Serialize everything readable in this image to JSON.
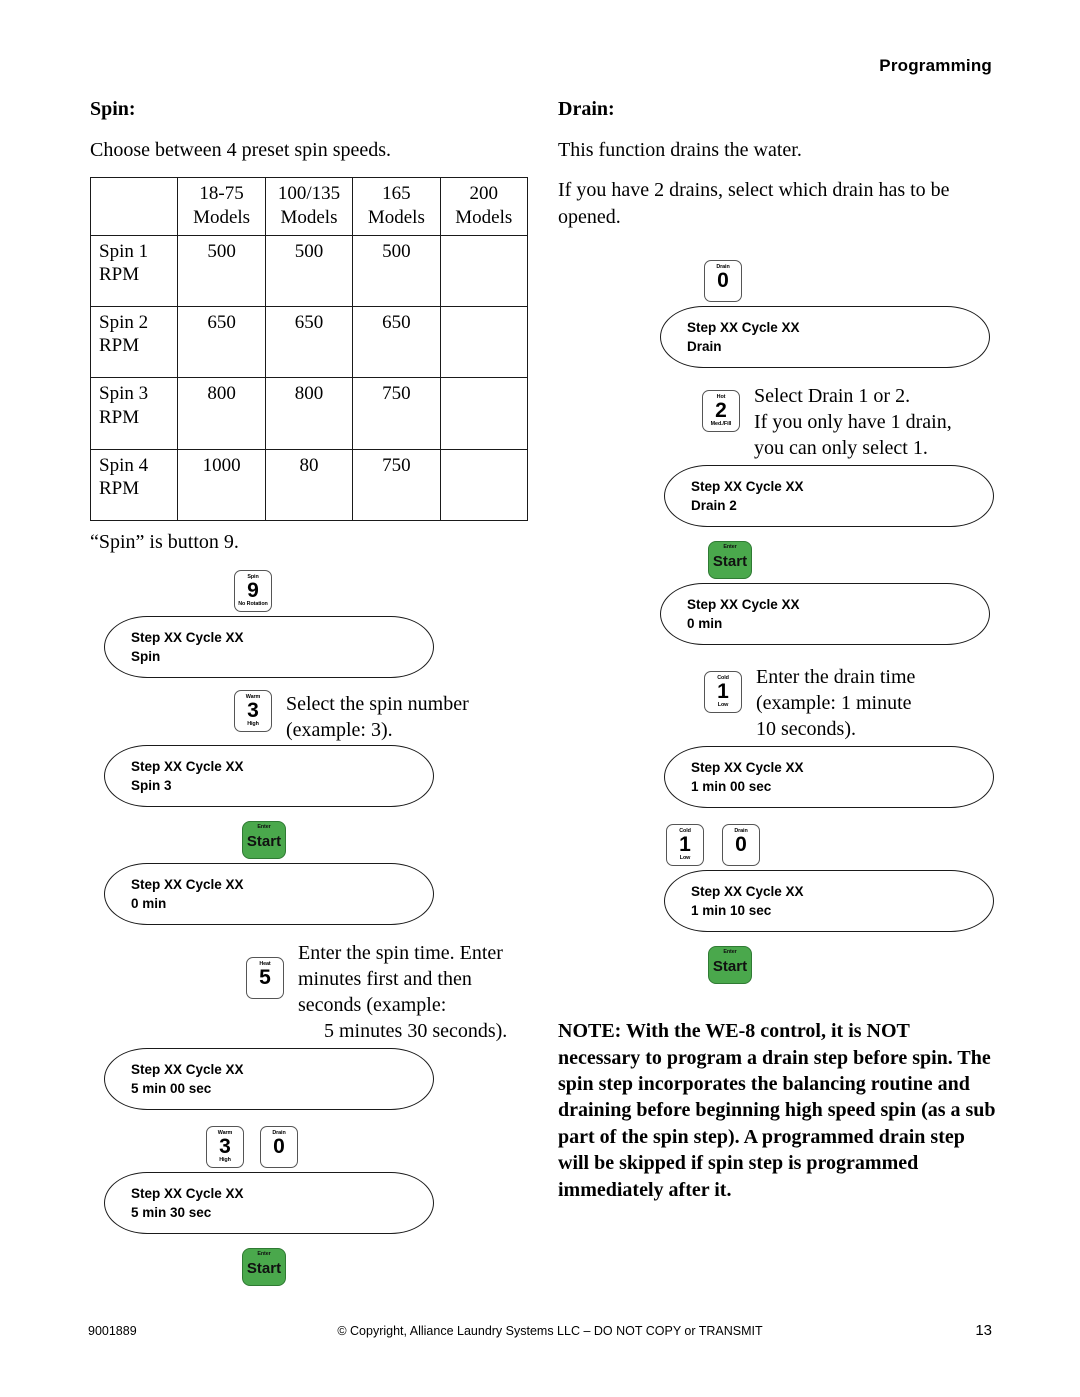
{
  "header": {
    "title": "Programming"
  },
  "left": {
    "section_title": "Spin:",
    "intro": "Choose between 4 preset spin speeds.",
    "table": {
      "headers": [
        "",
        "18-75\nModels",
        "100/135\nModels",
        "165\nModels",
        "200\nModels"
      ],
      "header_cells": [
        {
          "line1": "",
          "line2": ""
        },
        {
          "line1": "18-75",
          "line2": "Models"
        },
        {
          "line1": "100/135",
          "line2": "Models"
        },
        {
          "line1": "165",
          "line2": "Models"
        },
        {
          "line1": "200",
          "line2": "Models"
        }
      ],
      "rows": [
        {
          "label_line1": "Spin 1",
          "label_line2": "RPM",
          "v1": "500",
          "v2": "500",
          "v3": "500",
          "v4": ""
        },
        {
          "label_line1": "Spin 2",
          "label_line2": "RPM",
          "v1": "650",
          "v2": "650",
          "v3": "650",
          "v4": ""
        },
        {
          "label_line1": "Spin 3",
          "label_line2": "RPM",
          "v1": "800",
          "v2": "800",
          "v3": "750",
          "v4": ""
        },
        {
          "label_line1": "Spin 4",
          "label_line2": "RPM",
          "v1": "1000",
          "v2": "80",
          "v3": "750",
          "v4": ""
        }
      ]
    },
    "button_caption": "“Spin” is button 9.",
    "step1": {
      "key": {
        "top": "Spin",
        "num": "9",
        "bottom": "No Rotation"
      },
      "display": {
        "line1": "Step XX Cycle XX",
        "line2": "Spin"
      }
    },
    "step2": {
      "key": {
        "top": "Warm",
        "num": "3",
        "bottom": "High"
      },
      "note_line1": "Select the spin number",
      "note_line2": "(example: 3).",
      "display": {
        "line1": "Step XX Cycle XX",
        "line2": "Spin 3"
      }
    },
    "step3": {
      "key": {
        "top": "Enter",
        "word": "Start"
      },
      "display": {
        "line1": "Step XX Cycle XX",
        "line2": "0 min"
      }
    },
    "step4": {
      "key": {
        "top": "Heat",
        "num": "5",
        "bottom": ""
      },
      "note_line1": "Enter the spin time. Enter",
      "note_line2": "minutes first and then",
      "note_line3": "seconds (example:",
      "note_line4": "5 minutes 30 seconds).",
      "display": {
        "line1": "Step XX Cycle XX",
        "line2": "5 min 00 sec"
      }
    },
    "step5": {
      "key_a": {
        "top": "Warm",
        "num": "3",
        "bottom": "High"
      },
      "key_b": {
        "top": "Drain",
        "num": "0",
        "bottom": ""
      },
      "display": {
        "line1": "Step XX Cycle XX",
        "line2": "5 min 30 sec"
      }
    },
    "step6": {
      "key": {
        "top": "Enter",
        "word": "Start"
      }
    }
  },
  "right": {
    "section_title": "Drain:",
    "intro1": "This function drains the water.",
    "intro2": "If you have 2 drains, select which drain has to be opened.",
    "step1": {
      "key": {
        "top": "Drain",
        "num": "0",
        "bottom": ""
      },
      "display": {
        "line1": "Step XX Cycle XX",
        "line2": "Drain"
      }
    },
    "step2": {
      "key": {
        "top": "Hot",
        "num": "2",
        "bottom": "Med./Fill"
      },
      "note_line1": "Select Drain 1 or 2.",
      "note_line2": "If you only have 1 drain,",
      "note_line3": "you can only select 1.",
      "display": {
        "line1": "Step XX Cycle XX",
        "line2": "Drain 2"
      }
    },
    "step3": {
      "key": {
        "top": "Enter",
        "word": "Start"
      },
      "display": {
        "line1": "Step XX Cycle XX",
        "line2": "0 min"
      }
    },
    "step4": {
      "key": {
        "top": "Cold",
        "num": "1",
        "bottom": "Low"
      },
      "note_line1": "Enter the drain time",
      "note_line2": "(example: 1 minute",
      "note_line3": "10 seconds).",
      "display": {
        "line1": "Step XX Cycle XX",
        "line2": "1 min 00 sec"
      }
    },
    "step5": {
      "key_a": {
        "top": "Cold",
        "num": "1",
        "bottom": "Low"
      },
      "key_b": {
        "top": "Drain",
        "num": "0",
        "bottom": ""
      },
      "display": {
        "line1": "Step XX Cycle XX",
        "line2": "1 min 10 sec"
      }
    },
    "step6": {
      "key": {
        "top": "Enter",
        "word": "Start"
      }
    },
    "note": "NOTE: With the WE-8 control, it is NOT necessary to program a drain step before spin. The spin step incorporates the balancing routine and draining before beginning high speed spin (as a sub part of the spin step). A programmed drain step will be skipped if spin step is programmed immediately after it."
  },
  "footer": {
    "doc_number": "9001889",
    "copyright": "© Copyright, Alliance Laundry Systems LLC – DO NOT COPY or TRANSMIT",
    "page_number": "13"
  },
  "colors": {
    "start_button_green": "#4aa84c",
    "text": "#000000",
    "border": "#1a1a1a"
  }
}
